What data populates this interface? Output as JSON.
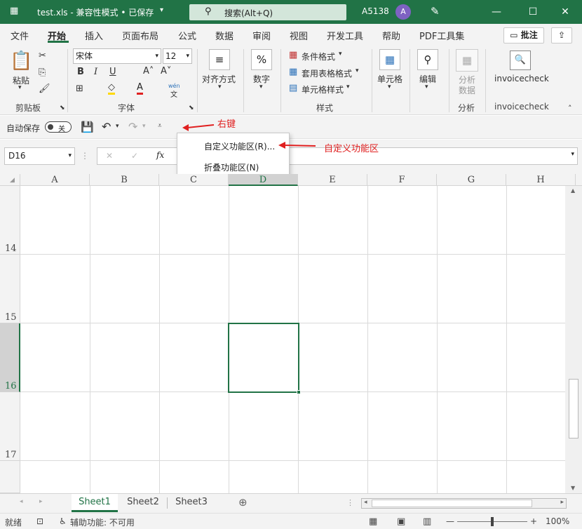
{
  "title": "test.xls  -  兼容性模式 • 已保存",
  "search": {
    "label": "搜索(Alt+Q)"
  },
  "user": {
    "name": "A5138",
    "initial": "A"
  },
  "tabs": [
    "文件",
    "开始",
    "插入",
    "页面布局",
    "公式",
    "数据",
    "审阅",
    "视图",
    "开发工具",
    "帮助",
    "PDF工具集"
  ],
  "comments_label": "批注",
  "ribbon": {
    "paste": "粘贴",
    "clipboard": "剪贴板",
    "font_name": "宋体",
    "font_size": "12",
    "font_group": "字体",
    "align": "对齐方式",
    "number": "数字",
    "cond_format": "条件格式",
    "table_format": "套用表格格式",
    "cell_style": "单元格样式",
    "styles_group": "样式",
    "cells": "单元格",
    "editing": "编辑",
    "analyze_line1": "分析",
    "analyze_line2": "数据",
    "analyze_group": "分析",
    "invoicecheck": "invoicecheck",
    "invoicecheck_group": "invoicecheck",
    "wen": "wén",
    "wen2": "文"
  },
  "qat": {
    "autosave": "自动保存",
    "toggle": "关"
  },
  "context_menu": {
    "items": [
      "自定义功能区(R)...",
      "折叠功能区(N)"
    ]
  },
  "annotations": {
    "right_click": "右键",
    "customize": "自定义功能区"
  },
  "namebox": "D16",
  "columns": [
    "A",
    "B",
    "C",
    "D",
    "E",
    "F",
    "G",
    "H"
  ],
  "rows": [
    "14",
    "15",
    "16",
    "17"
  ],
  "sheets": [
    "Sheet1",
    "Sheet2",
    "Sheet3"
  ],
  "status": {
    "ready": "就绪",
    "accessibility": "辅助功能: 不可用",
    "zoom": "100%"
  },
  "colors": {
    "accent": "#217346",
    "annotation": "#e02020"
  }
}
